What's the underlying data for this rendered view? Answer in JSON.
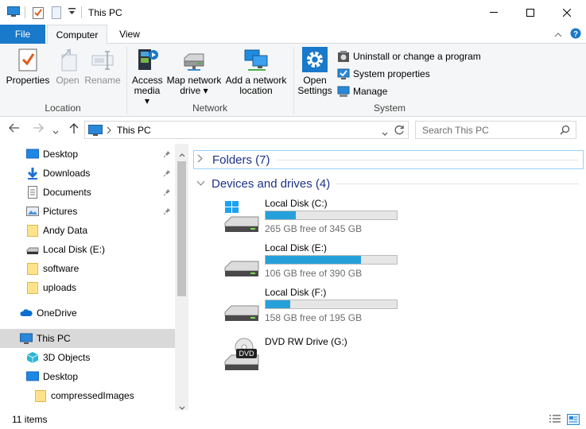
{
  "window": {
    "title": "This PC",
    "minimize_glyph": "—",
    "maximize_glyph": "☐",
    "close_glyph": "✕"
  },
  "ribbon_tabs": [
    {
      "label": "File",
      "active": false
    },
    {
      "label": "Computer",
      "active": true
    },
    {
      "label": "View",
      "active": false
    }
  ],
  "ribbon": {
    "location": {
      "label": "Location",
      "properties": "Properties",
      "open": "Open",
      "rename": "Rename"
    },
    "network": {
      "label": "Network",
      "access_media_1": "Access",
      "access_media_2": "media ▾",
      "map_drive_1": "Map network",
      "map_drive_2": "drive ▾",
      "add_location_1": "Add a network",
      "add_location_2": "location"
    },
    "system": {
      "label": "System",
      "open_settings_1": "Open",
      "open_settings_2": "Settings",
      "uninstall": "Uninstall or change a program",
      "system_properties": "System properties",
      "manage": "Manage"
    }
  },
  "address": {
    "path": "This PC",
    "search_placeholder": "Search This PC"
  },
  "sidebar": {
    "items": [
      {
        "label": "Desktop",
        "icon": "desktop-icon",
        "pinned": true
      },
      {
        "label": "Downloads",
        "icon": "downloads-icon",
        "pinned": true
      },
      {
        "label": "Documents",
        "icon": "documents-icon",
        "pinned": true
      },
      {
        "label": "Pictures",
        "icon": "pictures-icon",
        "pinned": true
      },
      {
        "label": "Andy Data",
        "icon": "folder-icon",
        "pinned": false
      },
      {
        "label": "Local Disk (E:)",
        "icon": "drive-icon",
        "pinned": false
      },
      {
        "label": "software",
        "icon": "folder-icon",
        "pinned": false
      },
      {
        "label": "uploads",
        "icon": "folder-icon",
        "pinned": false
      },
      {
        "label": "OneDrive",
        "icon": "onedrive-icon",
        "pinned": false
      },
      {
        "label": "This PC",
        "icon": "this-pc-icon",
        "pinned": false,
        "selected": true
      },
      {
        "label": "3D Objects",
        "icon": "3d-objects-icon",
        "pinned": false
      },
      {
        "label": "Desktop",
        "icon": "desktop-icon",
        "pinned": false
      },
      {
        "label": "compressedImages",
        "icon": "folder-icon",
        "pinned": false
      }
    ]
  },
  "main": {
    "folders_header": "Folders (7)",
    "drives_header": "Devices and drives (4)",
    "drives": [
      {
        "name": "Local Disk (C:)",
        "free": "265 GB free of 345 GB",
        "used_fraction": 0.23,
        "icon": "windows-drive-icon"
      },
      {
        "name": "Local Disk (E:)",
        "free": "106 GB free of 390 GB",
        "used_fraction": 0.73,
        "icon": "drive-icon"
      },
      {
        "name": "Local Disk (F:)",
        "free": "158 GB free of 195 GB",
        "used_fraction": 0.19,
        "icon": "drive-icon"
      },
      {
        "name": "DVD RW Drive (G:)",
        "free": "",
        "used_fraction": null,
        "icon": "dvd-drive-icon"
      }
    ]
  },
  "status": {
    "items": "11 items"
  },
  "colors": {
    "accent": "#1979ca",
    "bar_fill": "#26a0da",
    "header_text": "#1e3287"
  }
}
